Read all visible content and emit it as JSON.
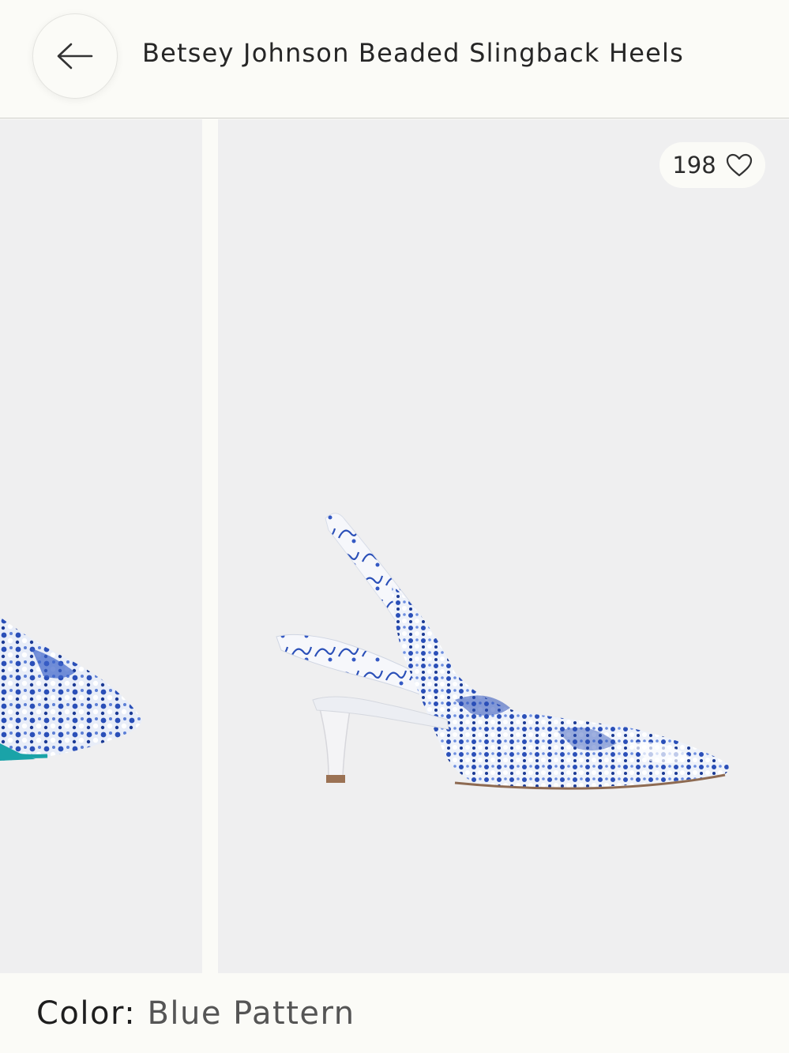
{
  "header": {
    "back_icon": "arrow-left-icon",
    "title": "Betsey Johnson Beaded Slingback Heels"
  },
  "gallery": {
    "likes": "198",
    "like_icon": "heart-outline-icon"
  },
  "footer": {
    "color_label": "Color:",
    "color_value": "Blue Pattern"
  },
  "colors": {
    "background": "#fbfbf7",
    "photo_bg": "#efeff0",
    "pattern_blue": "#2a4fb8",
    "sole_teal": "#1aa3a8"
  }
}
